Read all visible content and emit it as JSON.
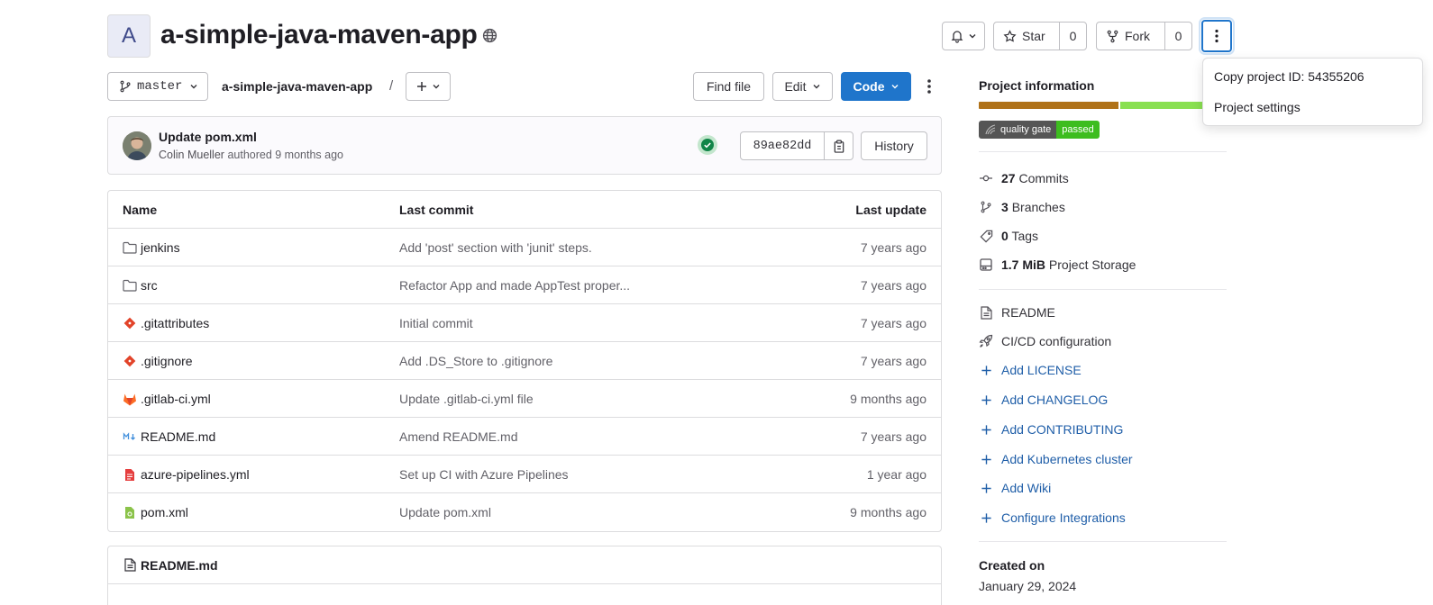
{
  "project": {
    "avatar_letter": "A",
    "title": "a-simple-java-maven-app"
  },
  "actions": {
    "star_label": "Star",
    "star_count": "0",
    "fork_label": "Fork",
    "fork_count": "0"
  },
  "menu": {
    "copy_id": "Copy project ID: 54355206",
    "settings": "Project settings"
  },
  "toolbar": {
    "branch": "master",
    "breadcrumb": "a-simple-java-maven-app",
    "breadcrumb_sep": "/",
    "find_file": "Find file",
    "edit": "Edit",
    "code": "Code"
  },
  "last_commit": {
    "title": "Update pom.xml",
    "author": "Colin Mueller",
    "authored_text": "authored 9 months ago",
    "sha": "89ae82dd",
    "history": "History"
  },
  "file_table": {
    "headers": {
      "name": "Name",
      "last_commit": "Last commit",
      "last_update": "Last update"
    },
    "rows": [
      {
        "name": "jenkins",
        "commit": "Add 'post' section with 'junit' steps.",
        "date": "7 years ago",
        "icon": "folder-icon"
      },
      {
        "name": "src",
        "commit": "Refactor App and made AppTest proper...",
        "date": "7 years ago",
        "icon": "folder-icon"
      },
      {
        "name": ".gitattributes",
        "commit": "Initial commit",
        "date": "7 years ago",
        "icon": "git-icon"
      },
      {
        "name": ".gitignore",
        "commit": "Add .DS_Store to .gitignore",
        "date": "7 years ago",
        "icon": "git-icon"
      },
      {
        "name": ".gitlab-ci.yml",
        "commit": "Update .gitlab-ci.yml file",
        "date": "9 months ago",
        "icon": "gitlab-icon"
      },
      {
        "name": "README.md",
        "commit": "Amend README.md",
        "date": "7 years ago",
        "icon": "markdown-icon"
      },
      {
        "name": "azure-pipelines.yml",
        "commit": "Set up CI with Azure Pipelines",
        "date": "1 year ago",
        "icon": "yaml-icon"
      },
      {
        "name": "pom.xml",
        "commit": "Update pom.xml",
        "date": "9 months ago",
        "icon": "xml-icon"
      }
    ]
  },
  "readme": {
    "title": "README.md"
  },
  "sidebar": {
    "project_info": "Project information",
    "badge_left": "quality gate",
    "badge_right": "passed",
    "stats": {
      "commits_count": "27",
      "commits_label": "Commits",
      "branches_count": "3",
      "branches_label": "Branches",
      "tags_count": "0",
      "tags_label": "Tags",
      "storage_size": "1.7 MiB",
      "storage_label": "Project Storage"
    },
    "links": {
      "readme": "README",
      "cicd": "CI/CD configuration",
      "add_license": "Add LICENSE",
      "add_changelog": "Add CHANGELOG",
      "add_contributing": "Add CONTRIBUTING",
      "add_k8s": "Add Kubernetes cluster",
      "add_wiki": "Add Wiki",
      "configure_integrations": "Configure Integrations"
    },
    "created_label": "Created on",
    "created_date": "January 29, 2024"
  },
  "colors": {
    "accent": "#1f75cb",
    "link": "#1f5ea8",
    "lang_java": "#b07219",
    "lang_other": "#89e051",
    "badge_passed": "#3dbd1f"
  }
}
